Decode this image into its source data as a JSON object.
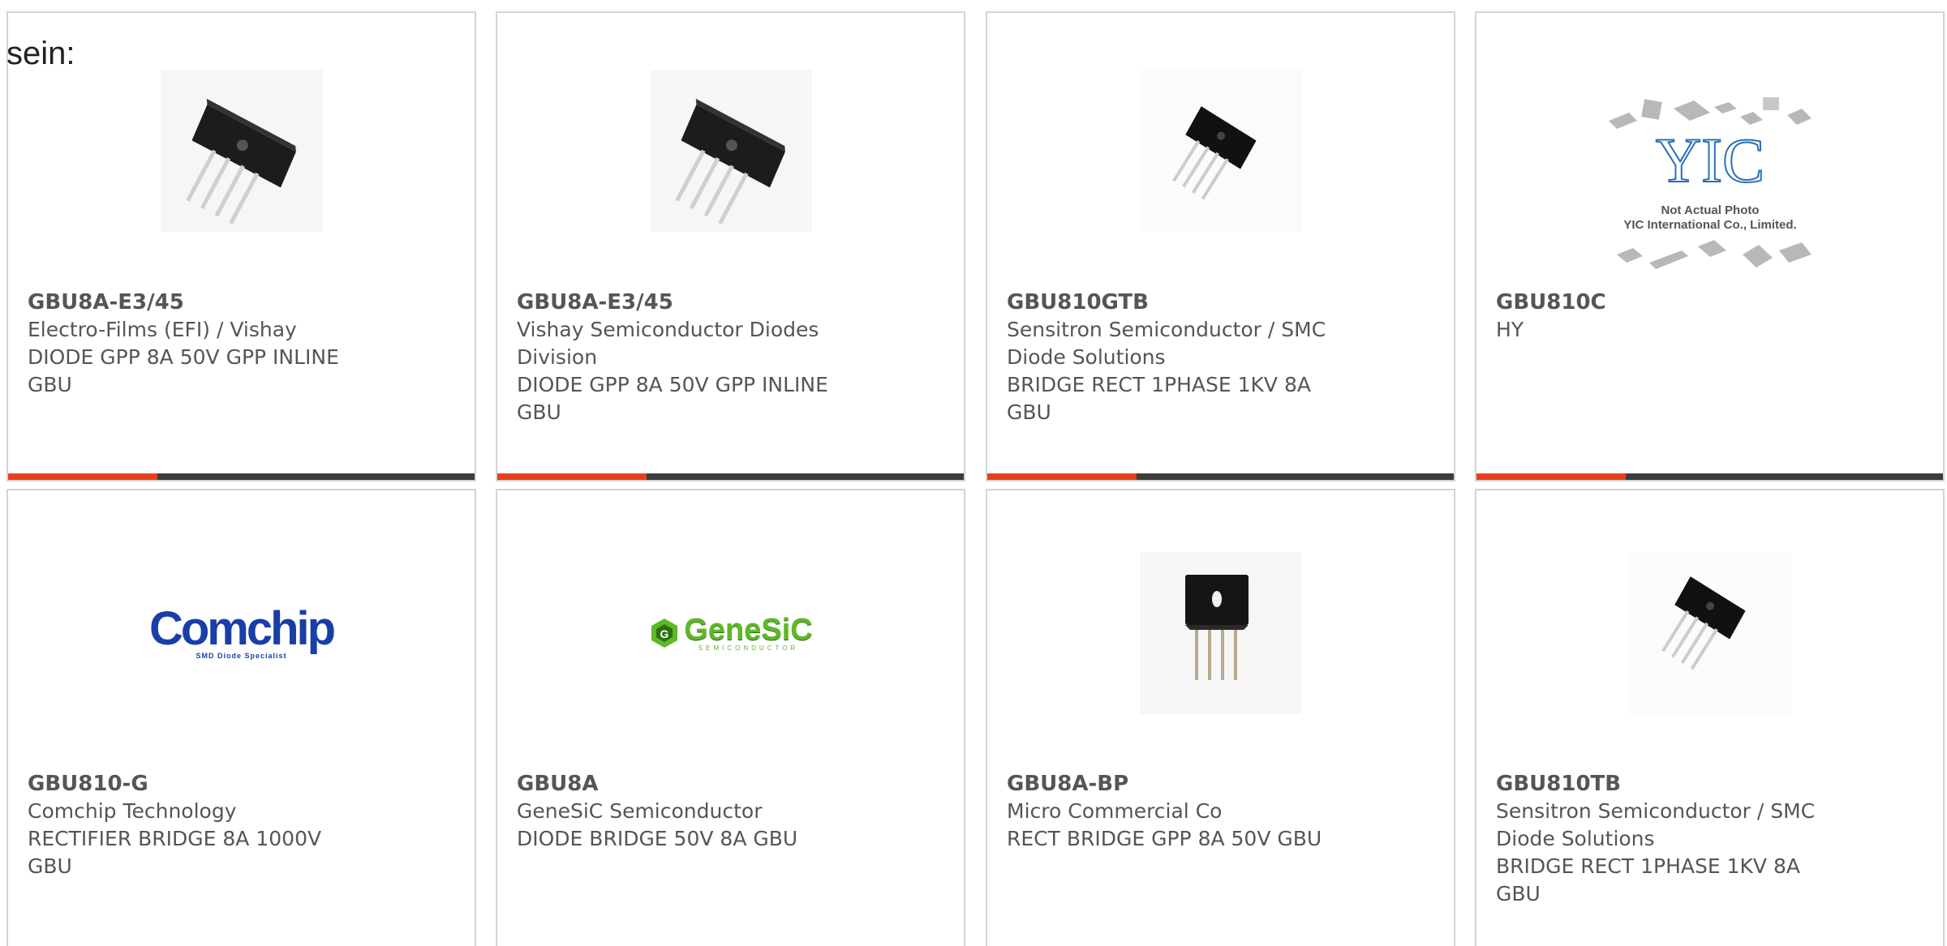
{
  "intro_text": "sein:",
  "products": [
    {
      "part_number": "GBU8A-E3/45",
      "manufacturer": "Electro-Films (EFI) / Vishay",
      "description": "DIODE GPP 8A 50V GPP INLINE",
      "package": "GBU",
      "image": "gbu-bridge-angled"
    },
    {
      "part_number": "GBU8A-E3/45",
      "manufacturer": "Vishay Semiconductor Diodes Division",
      "description": "DIODE GPP 8A 50V GPP INLINE",
      "package": "GBU",
      "image": "gbu-bridge-angled"
    },
    {
      "part_number": "GBU810GTB",
      "manufacturer": "Sensitron Semiconductor / SMC Diode Solutions",
      "description": "BRIDGE RECT 1PHASE 1KV 8A",
      "package": "GBU",
      "image": "gbu-bridge-small"
    },
    {
      "part_number": "GBU810C",
      "manufacturer": "HY",
      "description": "",
      "package": "",
      "image": "yic-placeholder",
      "image_note_line1": "Not Actual Photo",
      "image_note_line2": "YIC International Co., Limited."
    },
    {
      "part_number": "GBU810-G",
      "manufacturer": "Comchip Technology",
      "description": "RECTIFIER BRIDGE 8A 1000V",
      "package": "GBU",
      "image": "comchip-logo",
      "logo_text": "Comchip",
      "logo_tagline": "SMD Diode Specialist"
    },
    {
      "part_number": "GBU8A",
      "manufacturer": "GeneSiC Semiconductor",
      "description": "DIODE BRIDGE 50V 8A GBU",
      "package": "",
      "image": "genesic-logo",
      "logo_text": "GeneSiC",
      "logo_tagline": "SEMICONDUCTOR"
    },
    {
      "part_number": "GBU8A-BP",
      "manufacturer": "Micro Commercial Co",
      "description": "RECT BRIDGE GPP 8A 50V GBU",
      "package": "",
      "image": "gbu-bridge-front"
    },
    {
      "part_number": "GBU810TB",
      "manufacturer": "Sensitron Semiconductor / SMC Diode Solutions",
      "description": "BRIDGE RECT 1PHASE 1KV 8A",
      "package": "GBU",
      "image": "gbu-bridge-small"
    }
  ],
  "colors": {
    "accent": "#e8401c",
    "bar_dark": "#3c3c3c",
    "text": "#555555",
    "border": "#d4d4d4"
  }
}
